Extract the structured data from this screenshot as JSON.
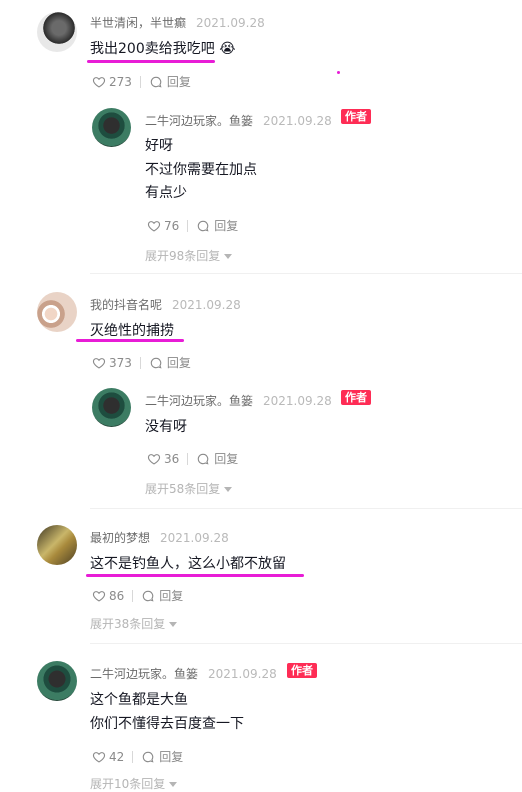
{
  "author_badge": "作者",
  "comments": [
    {
      "user": "半世清闲，半世癫",
      "date": "2021.09.28",
      "text": "我出200卖给我吃吧",
      "emoji": "😭",
      "likes": "273",
      "reply_label": "回复",
      "reply": {
        "user": "二牛河边玩家。鱼篓",
        "date": "2021.09.28",
        "lines": [
          "好呀",
          "不过你需要在加点",
          "有点少"
        ],
        "likes": "76",
        "reply_label": "回复"
      },
      "expand": "展开98条回复"
    },
    {
      "user": "我的抖音名呢",
      "date": "2021.09.28",
      "text": "灭绝性的捕捞",
      "likes": "373",
      "reply_label": "回复",
      "reply": {
        "user": "二牛河边玩家。鱼篓",
        "date": "2021.09.28",
        "lines": [
          "没有呀"
        ],
        "likes": "36",
        "reply_label": "回复"
      },
      "expand": "展开58条回复"
    },
    {
      "user": "最初的梦想",
      "date": "2021.09.28",
      "text": "这不是钓鱼人，这么小都不放留",
      "likes": "86",
      "reply_label": "回复",
      "expand": "展开38条回复"
    },
    {
      "user": "二牛河边玩家。鱼篓",
      "date": "2021.09.28",
      "lines": [
        "这个鱼都是大鱼",
        "你们不懂得去百度查一下"
      ],
      "likes": "42",
      "reply_label": "回复",
      "expand": "展开10条回复"
    }
  ],
  "colors": {
    "badge": "#fe2c55",
    "highlight": "#e81cd6"
  }
}
